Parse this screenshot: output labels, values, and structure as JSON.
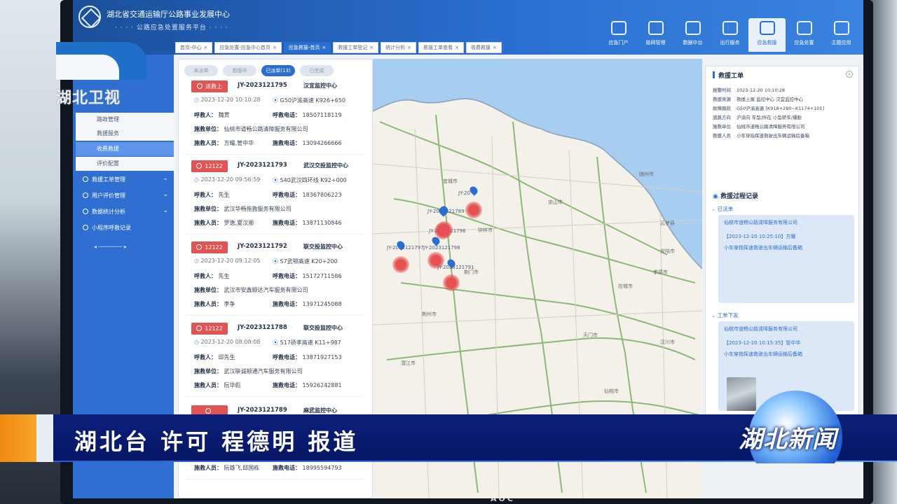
{
  "header": {
    "title": "湖北省交通运输厅公路事业发展中心",
    "subtitle": "· · · · 公路应急处置服务平台 · · · ·",
    "nav": [
      "应急门户",
      "路网管理",
      "数据中台",
      "出行服务",
      "应急救援",
      "应急处置",
      "主题应用"
    ]
  },
  "sidebar": {
    "items": [
      "路政管理",
      "救援服务",
      "收费救援",
      "评价配置",
      "救援工单管理",
      "用户评价管理",
      "数据统计分析",
      "小程序呼救记录"
    ]
  },
  "tabs": [
    "首页-中心",
    "应急处置-应急中心首页",
    "应急救援-首页",
    "救援工单登记",
    "统计分析",
    "救援工单查看",
    "收费救援"
  ],
  "list_panel": {
    "filters": [
      "未派单",
      "救援中",
      "已派单(13)",
      "已完成"
    ],
    "cards": [
      {
        "badge": "派救上",
        "id": "JY-2023121795",
        "center": "汉宜监控中心",
        "time": "2023-12-20 10:10:28",
        "loc": "G50沪渝高速 K926+650",
        "caller": "魏贯",
        "phone": "18507118119",
        "unit": "仙桃市道畅公路清障服务有限公司",
        "staff": "方耀,管中华",
        "staff_phone": "13094266666"
      },
      {
        "badge": "12122",
        "id": "JY-2023121793",
        "center": "武汉交投监控中心",
        "time": "2023-12-20 09:56:59",
        "loc": "S40武汉四环线 K92+000",
        "caller": "先生",
        "phone": "18367806223",
        "unit": "武汉华畅拖救服务有限公司",
        "staff": "罗逸,夏汉顺",
        "staff_phone": "13871130846"
      },
      {
        "badge": "12122",
        "id": "JY-2023121792",
        "center": "联交投监控中心",
        "time": "2023-12-20 09:12:05",
        "loc": "S7武鄂高速 K20+200",
        "caller": "先生",
        "phone": "15172711586",
        "unit": "武汉市安鑫顺达汽车服务有限公司",
        "staff": "李争",
        "staff_phone": "13971245088"
      },
      {
        "badge": "12122",
        "id": "JY-2023121788",
        "center": "联交投监控中心",
        "time": "2023-12-20 08:08:08",
        "loc": "S17硚孝高速 K11+987",
        "caller": "邱先生",
        "phone": "13871927153",
        "unit": "武汉联诚顺通汽车服务有限公司",
        "staff": "阮华彪",
        "staff_phone": "15926242881"
      },
      {
        "badge": "",
        "id": "JY-2023121789",
        "center": "麻武监控中心",
        "time": "",
        "loc": "",
        "caller": "",
        "phone": "",
        "unit": "",
        "staff": "阮雄飞,邱国栋",
        "staff_phone": "18995594793"
      }
    ],
    "labels": {
      "caller": "呼救人：",
      "phone": "呼救电话：",
      "unit": "施救单位：",
      "staff": "施救人员：",
      "staff_phone": "施救电话："
    }
  },
  "map": {
    "markers": [
      {
        "label": "JY-2023121775"
      },
      {
        "label": "JY-2023121790"
      },
      {
        "label": "JY-2023121779"
      },
      {
        "label": "JY-2023121789"
      },
      {
        "label": "JY-2023121796"
      },
      {
        "label": "JY-2023121798"
      },
      {
        "label": "JY-20"
      },
      {
        "label": "JY-2023121797"
      },
      {
        "label": "JY-2023121791"
      }
    ],
    "towns": [
      "宜城市",
      "潜江市",
      "荆门市",
      "京山市",
      "孝感市",
      "武汉",
      "仙桃市",
      "汉川市",
      "天门市",
      "随州市",
      "钟祥市",
      "云梦县",
      "荆州市",
      "应城市",
      "安陆市"
    ]
  },
  "right_panel": {
    "title": "救援工单",
    "rows": [
      {
        "k": "报警时间",
        "v": "2023-12-20 10:10:28"
      },
      {
        "k": "救援来源",
        "v": "救援上报  监控中心    汉宜监控中心"
      },
      {
        "k": "故障路段",
        "v": "G50沪渝高速 [K918+280~K1174+101]"
      },
      {
        "k": "道路方向",
        "v": "沪渝向          车型/所在    小型轿车/爆胎"
      },
      {
        "k": "施救单位",
        "v": "仙桃市道畅公路清障服务有限公司"
      },
      {
        "k": "救援人员",
        "v": "小车穿指挥速救驶出车辆运输后备箱"
      }
    ],
    "process_title": "救援过程记录",
    "timeline": [
      {
        "status": "已派单",
        "lines": [
          "仙桃市道畅公路清障服务有限公司",
          "【2023-12-20 10:25:10】方耀",
          "小车穿指挥速救驶出车辆运输后备箱"
        ]
      },
      {
        "status": "工单下发",
        "lines": [
          "仙桃市道畅公路清障服务有限公司",
          "【2023-12-20 10:15:35】管中华",
          "小车穿指挥速救驶出车辆运输后备箱"
        ]
      }
    ]
  },
  "tv": {
    "station_logo_text": "湖北卫视",
    "lower_third": "湖北台 许可 程德明 报道",
    "program_brand": "湖北新闻",
    "monitor_brand": "AOC"
  },
  "colors": {
    "accent": "#2a6fd0",
    "alert": "#e05454",
    "lower_third": "#0c1f7a",
    "orange": "#f08a12"
  }
}
